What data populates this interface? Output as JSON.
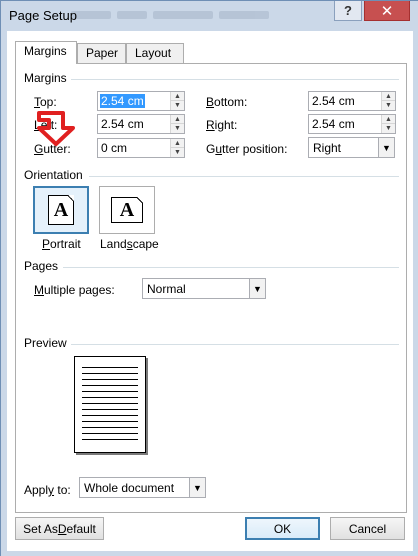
{
  "window": {
    "title": "Page Setup",
    "help_label": "?",
    "close_label": "✕"
  },
  "tabs": [
    {
      "label": "Margins",
      "active": true
    },
    {
      "label": "Paper",
      "active": false
    },
    {
      "label": "Layout",
      "active": false
    }
  ],
  "margins": {
    "section_label": "Margins",
    "top": {
      "label": "Top:",
      "mnemonic": "T",
      "rest": "op:",
      "value": "2.54 cm"
    },
    "bottom": {
      "label": "Bottom:",
      "mnemonic": "B",
      "rest": "ottom:",
      "value": "2.54 cm"
    },
    "left": {
      "label": "Left:",
      "mnemonic": "L",
      "rest": "eft:",
      "value": "2.54 cm"
    },
    "right": {
      "label": "Right:",
      "mnemonic": "R",
      "rest": "ight:",
      "value": "2.54 cm"
    },
    "gutter": {
      "label": "Gutter:",
      "mnemonic": "G",
      "rest": "utter:",
      "value": "0 cm"
    },
    "gutter_position": {
      "label": "Gutter position:",
      "pre": "G",
      "mnemonic": "u",
      "rest": "tter position:",
      "value": "Right"
    }
  },
  "orientation": {
    "section_label": "Orientation",
    "portrait": {
      "label": "Portrait",
      "mnemonic": "P",
      "rest": "ortrait",
      "glyph": "A",
      "selected": true
    },
    "landscape": {
      "label": "Landscape",
      "pre": "Land",
      "mnemonic": "s",
      "rest": "cape",
      "glyph": "A",
      "selected": false
    }
  },
  "pages": {
    "section_label": "Pages",
    "multiple_pages": {
      "label": "Multiple pages:",
      "mnemonic": "M",
      "rest": "ultiple pages:",
      "value": "Normal"
    }
  },
  "preview": {
    "section_label": "Preview"
  },
  "apply_to": {
    "label": "Apply to:",
    "pre": "Appl",
    "mnemonic": "y",
    "rest": " to:",
    "value": "Whole document"
  },
  "buttons": {
    "set_default": {
      "label": "Set As Default",
      "pre": "Set As ",
      "mnemonic": "D",
      "rest": "efault"
    },
    "ok": {
      "label": "OK"
    },
    "cancel": {
      "label": "Cancel"
    }
  },
  "annotation": {
    "color": "#e02020"
  },
  "colors": {
    "title_bar": "#cbd8e8",
    "close_button": "#c75050",
    "selection": "#3399ff",
    "focus_border": "#3c7fb1"
  }
}
